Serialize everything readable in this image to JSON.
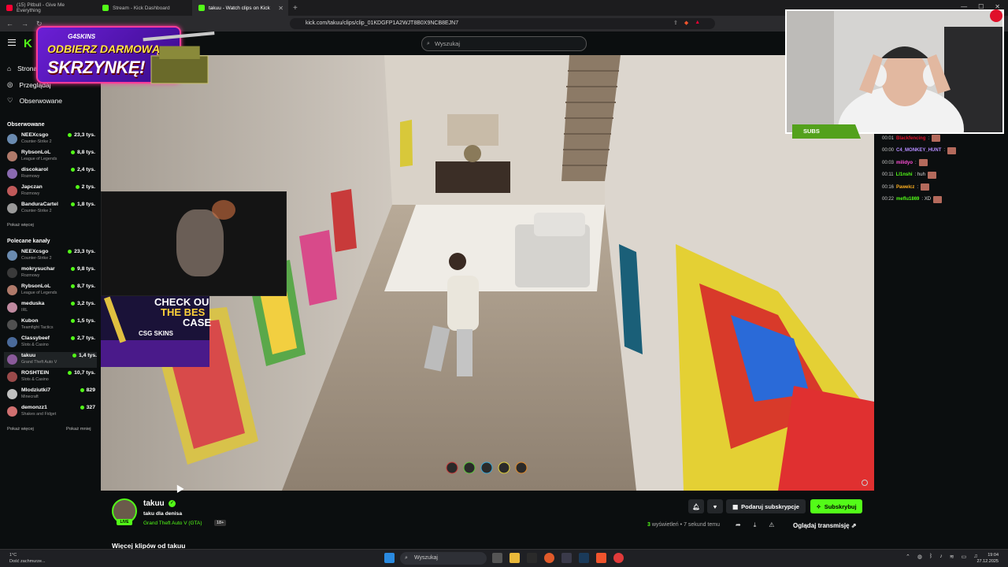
{
  "browser": {
    "tabs": [
      {
        "title": "(15) Pitbull - Give Me Everything",
        "color": "#ff0033"
      },
      {
        "title": "Stream - Kick Dashboard",
        "color": "#53fc18"
      },
      {
        "title": "takuu - Watch clips on Kick",
        "color": "#53fc18"
      }
    ],
    "new_tab": "+",
    "url": "kick.com/takuu/clips/clip_01KDGFP1A2WJT8B0X9NCB8EJN7"
  },
  "header": {
    "logo": "K",
    "search_placeholder": "Wyszukaj"
  },
  "sidebar": {
    "nav": [
      {
        "label": "Strona główna",
        "icon": "home-icon"
      },
      {
        "label": "Przeglądaj",
        "icon": "compass-icon"
      },
      {
        "label": "Obserwowane",
        "icon": "heart-icon"
      }
    ],
    "followed_heading": "Obserwowane",
    "followed": [
      {
        "name": "NEEXcsgo",
        "game": "Counter-Strike 2",
        "viewers": "23,3 tys.",
        "color": "#6a8bb0"
      },
      {
        "name": "RybsonLoL",
        "game": "League of Legends",
        "viewers": "8,8 tys.",
        "color": "#b07a6a"
      },
      {
        "name": "discokarol",
        "game": "Rozmowy",
        "viewers": "2,4 tys.",
        "color": "#8a6ab0"
      },
      {
        "name": "Japczan",
        "game": "Rozmowy",
        "viewers": "2 tys.",
        "color": "#c05a5a"
      },
      {
        "name": "BanduraCartel",
        "game": "Counter-Strike 2",
        "viewers": "1,8 tys.",
        "color": "#9a9a9a"
      }
    ],
    "followed_more": "Pokaż więcej",
    "recommended_heading": "Polecane kanały",
    "recommended": [
      {
        "name": "NEEXcsgo",
        "game": "Counter-Strike 2",
        "viewers": "23,3 tys.",
        "color": "#6a8bb0"
      },
      {
        "name": "mokrysuchar",
        "game": "Rozmowy",
        "viewers": "9,8 tys.",
        "color": "#3a3a3a"
      },
      {
        "name": "RybsonLoL",
        "game": "League of Legends",
        "viewers": "8,7 tys.",
        "color": "#b07a6a"
      },
      {
        "name": "meduska",
        "game": "IRL",
        "viewers": "3,2 tys.",
        "color": "#c08aa0"
      },
      {
        "name": "Kubon",
        "game": "Teamfight Tactics",
        "viewers": "1,5 tys.",
        "color": "#505050"
      },
      {
        "name": "Classybeef",
        "game": "Slots & Casino",
        "viewers": "2,7 tys.",
        "color": "#4a6a9a"
      },
      {
        "name": "takuu",
        "game": "Grand Theft Auto V",
        "viewers": "1,4 tys.",
        "color": "#8a5a9a"
      },
      {
        "name": "ROSHTEIN",
        "game": "Slots & Casino",
        "viewers": "10,7 tys.",
        "color": "#9a4a4a"
      },
      {
        "name": "Mlodziutki7",
        "game": "Minecraft",
        "viewers": "829",
        "color": "#c0c0c0"
      },
      {
        "name": "demonzz1",
        "game": "Shakes and Fidget",
        "viewers": "327",
        "color": "#d07070"
      }
    ],
    "recommended_more": "Pokaż więcej",
    "recommended_less": "Pokaż mniej"
  },
  "ad": {
    "brand": "G4SKINS",
    "line1": "ODBIERZ DARMOWĄ",
    "line2": "SKRZYNKĘ!"
  },
  "stream_overlay": {
    "csgo_text1": "CHECK OU",
    "csgo_text2": "THE BES",
    "csgo_text3": "CASE",
    "csgo_brand": "CSG SKINS",
    "subs_label": "SUBS"
  },
  "chat": [
    {
      "time": "00:01",
      "user": "Blackfencing",
      "msg": ":",
      "color": "#e0102a"
    },
    {
      "time": "00:00",
      "user": "C4_MONKEY_HUNT",
      "msg": ":",
      "color": "#b58cff"
    },
    {
      "time": "00:03",
      "user": "milidyo",
      "msg": ":",
      "color": "#ff4fd8"
    },
    {
      "time": "00:11",
      "user": "Ll1nshi",
      "msg": ": huh",
      "color": "#53fc18"
    },
    {
      "time": "00:16",
      "user": "Pawelcz",
      "msg": ":",
      "color": "#ffb020"
    },
    {
      "time": "00:22",
      "user": "meflu1869",
      "msg": ": XD",
      "color": "#53fc18"
    }
  ],
  "info": {
    "streamer": "takuu",
    "title": "taku dla denisa",
    "game": "Grand Theft Auto V (GTA)",
    "age": "18+",
    "live": "LIVE",
    "gift_button": "Podaruj subskrypcje",
    "subscribe_button": "Subskrybuj",
    "views_count": "3",
    "views_text": "wyświetleń",
    "time_ago": "• 7 sekund temu",
    "watch_stream": "Oglądaj transmisję",
    "more_clips": "Więcej klipów od takuu"
  },
  "taskbar": {
    "temp": "1°C",
    "weather": "Dość zachmurze...",
    "search": "Wyszukaj",
    "time": "19:04",
    "date": "27.12.2025"
  },
  "colors": {
    "kick_green": "#53fc18",
    "bg": "#0b0e0f"
  }
}
